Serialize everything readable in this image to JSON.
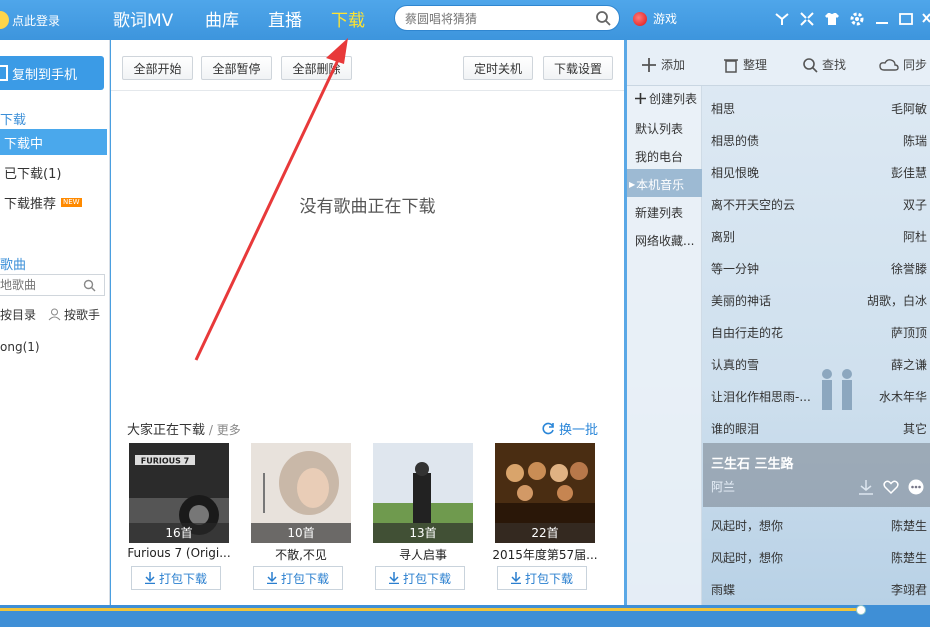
{
  "topbar": {
    "login": "点此登录",
    "nav": [
      "歌词MV",
      "曲库",
      "直播",
      "下载"
    ],
    "active_nav": "下载",
    "search_placeholder": "蔡圆唱将猜猜",
    "game": "游戏"
  },
  "left": {
    "copy_button": "复制到手机",
    "section_download": "下载",
    "items": [
      "下载中",
      "已下载(1)",
      "下载推荐"
    ],
    "new_badge": "NEW",
    "section_song": "歌曲",
    "search_placeholder": "地歌曲",
    "by_dir": "按目录",
    "by_singer": "按歌手",
    "song_entry": "ong(1)"
  },
  "toolbar": {
    "start_all": "全部开始",
    "pause_all": "全部暂停",
    "delete_all": "全部删除",
    "timer_shutdown": "定时关机",
    "download_settings": "下载设置"
  },
  "main": {
    "empty_message": "没有歌曲正在下载",
    "rec_title": "大家正在下载",
    "rec_more": "更多",
    "refresh": "换一批",
    "download_pack": "打包下载",
    "albums": [
      {
        "count": "16首",
        "name": "Furious 7 (Origi..."
      },
      {
        "count": "10首",
        "name": "不散,不见"
      },
      {
        "count": "13首",
        "name": "寻人启事"
      },
      {
        "count": "22首",
        "name": "2015年度第57届..."
      }
    ]
  },
  "right": {
    "tools": [
      "添加",
      "整理",
      "查找",
      "同步"
    ],
    "create_list": "创建列表",
    "lists": [
      "默认列表",
      "我的电台",
      "本机音乐",
      "新建列表",
      "网络收藏..."
    ],
    "active_list": "本机音乐",
    "songs": [
      {
        "title": "相思",
        "artist": "毛阿敏"
      },
      {
        "title": "相思的债",
        "artist": "陈瑞"
      },
      {
        "title": "相见恨晚",
        "artist": "彭佳慧"
      },
      {
        "title": "离不开天空的云",
        "artist": "双子"
      },
      {
        "title": "离别",
        "artist": "阿杜"
      },
      {
        "title": "等一分钟",
        "artist": "徐誉滕"
      },
      {
        "title": "美丽的神话",
        "artist": "胡歌，白冰"
      },
      {
        "title": "自由行走的花",
        "artist": "萨顶顶"
      },
      {
        "title": "认真的雪",
        "artist": "薛之谦"
      },
      {
        "title": "让泪化作相思雨-...",
        "artist": "水木年华"
      },
      {
        "title": "谁的眼泪",
        "artist": "其它"
      }
    ],
    "current": {
      "title": "三生石 三生路",
      "artist": "阿兰"
    },
    "songs_after": [
      {
        "title": "风起时，想你",
        "artist": "陈楚生"
      },
      {
        "title": "风起时，想你",
        "artist": "陈楚生"
      },
      {
        "title": "雨蝶",
        "artist": "李翊君"
      }
    ]
  },
  "colors": {
    "accent": "#3b9be6",
    "active_nav": "#ffe330",
    "arrow": "#e8393a"
  }
}
